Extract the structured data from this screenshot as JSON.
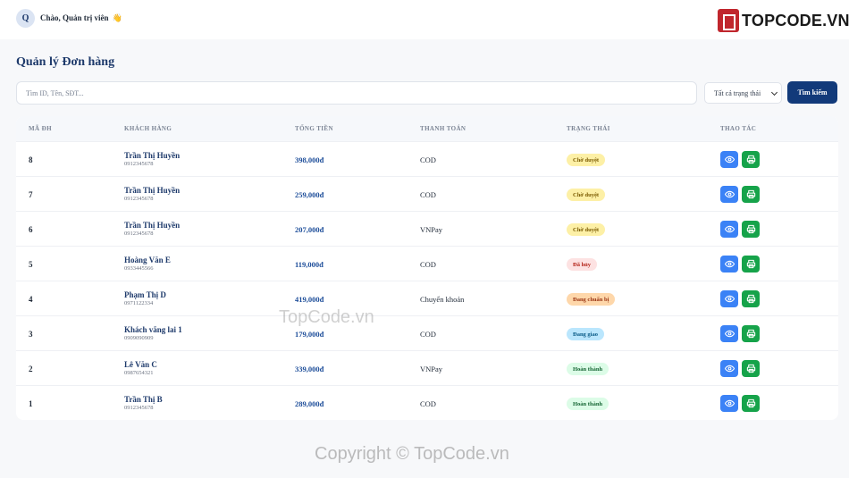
{
  "header": {
    "avatar_initial": "Q",
    "greeting": "Chào, Quản trị viên",
    "wave_emoji": "👋",
    "brand": "TOPCODE.VN"
  },
  "page": {
    "title": "Quản lý Đơn hàng"
  },
  "filters": {
    "search_placeholder": "Tìm ID, Tên, SĐT...",
    "status_selected": "Tất cả trạng thái",
    "search_button": "Tìm kiếm"
  },
  "table": {
    "columns": [
      "MÃ ĐH",
      "KHÁCH HÀNG",
      "TỔNG TIỀN",
      "THANH TOÁN",
      "TRẠNG THÁI",
      "THAO TÁC"
    ],
    "rows": [
      {
        "id": "8",
        "name": "Trần Thị Huyền",
        "phone": "0912345678",
        "total": "398,000đ",
        "payment": "COD",
        "status": "Chờ duyệt"
      },
      {
        "id": "7",
        "name": "Trần Thị Huyền",
        "phone": "0912345678",
        "total": "259,000đ",
        "payment": "COD",
        "status": "Chờ duyệt"
      },
      {
        "id": "6",
        "name": "Trần Thị Huyền",
        "phone": "0912345678",
        "total": "207,000đ",
        "payment": "VNPay",
        "status": "Chờ duyệt"
      },
      {
        "id": "5",
        "name": "Hoàng Văn E",
        "phone": "0933445566",
        "total": "119,000đ",
        "payment": "COD",
        "status": "Đã hủy"
      },
      {
        "id": "4",
        "name": "Phạm Thị D",
        "phone": "0971122334",
        "total": "419,000đ",
        "payment": "Chuyển khoản",
        "status": "Đang chuẩn bị"
      },
      {
        "id": "3",
        "name": "Khách vãng lai 1",
        "phone": "0909090909",
        "total": "179,000đ",
        "payment": "COD",
        "status": "Đang giao"
      },
      {
        "id": "2",
        "name": "Lê Văn C",
        "phone": "0987654321",
        "total": "339,000đ",
        "payment": "VNPay",
        "status": "Hoàn thành"
      },
      {
        "id": "1",
        "name": "Trần Thị B",
        "phone": "0912345678",
        "total": "289,000đ",
        "payment": "COD",
        "status": "Hoàn thành"
      }
    ]
  },
  "status_colors": {
    "Chờ duyệt": {
      "bg": "#fdf0a6",
      "fg": "#7a5a00"
    },
    "Đã hủy": {
      "bg": "#fde2e2",
      "fg": "#b42318"
    },
    "Đang chuẩn bị": {
      "bg": "#fed7aa",
      "fg": "#9a3412"
    },
    "Đang giao": {
      "bg": "#bae6fd",
      "fg": "#075985"
    },
    "Hoàn thành": {
      "bg": "#dcfce7",
      "fg": "#166534"
    }
  },
  "icons": {
    "view": "eye-icon",
    "print": "printer-icon"
  },
  "watermarks": {
    "center": "TopCode.vn",
    "footer": "Copyright © TopCode.vn"
  }
}
